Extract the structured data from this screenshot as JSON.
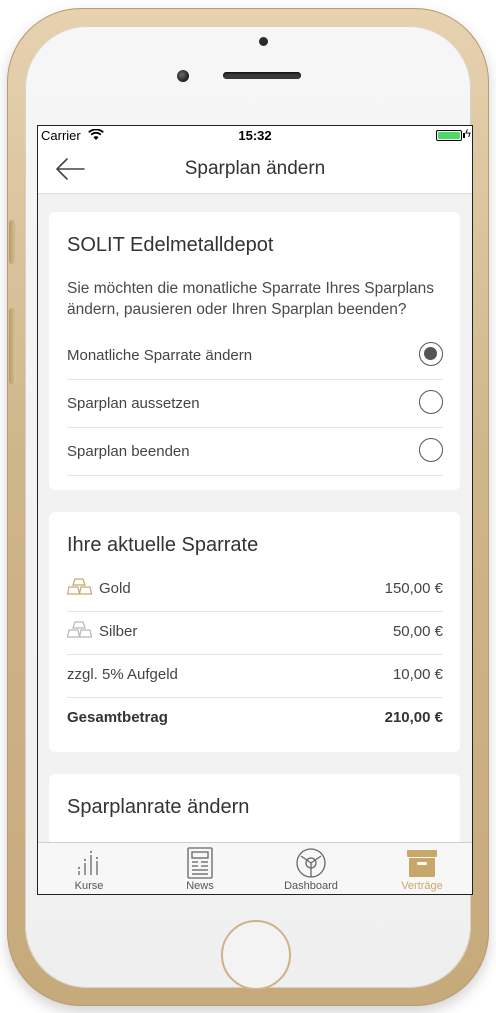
{
  "status": {
    "carrier": "Carrier",
    "time": "15:32"
  },
  "nav": {
    "title": "Sparplan ändern"
  },
  "card1": {
    "title": "SOLIT Edelmetalldepot",
    "description": "Sie möchten die monatliche Sparrate Ihres Sparplans ändern, pausieren oder Ihren Sparplan beenden?",
    "options": [
      {
        "label": "Monatliche Sparrate ändern",
        "selected": true
      },
      {
        "label": "Sparplan aussetzen",
        "selected": false
      },
      {
        "label": "Sparplan beenden",
        "selected": false
      }
    ]
  },
  "card2": {
    "title": "Ihre aktuelle Sparrate",
    "rows": [
      {
        "label": "Gold",
        "value": "150,00 €",
        "icon": "gold-bars-icon"
      },
      {
        "label": "Silber",
        "value": "50,00 €",
        "icon": "silver-bars-icon"
      },
      {
        "label": "zzgl. 5% Aufgeld",
        "value": "10,00 €"
      }
    ],
    "total": {
      "label": "Gesamtbetrag",
      "value": "210,00 €"
    }
  },
  "card3": {
    "title": "Sparplanrate ändern"
  },
  "tabs": [
    {
      "label": "Kurse",
      "icon": "chart-bars-icon"
    },
    {
      "label": "News",
      "icon": "newspaper-icon"
    },
    {
      "label": "Dashboard",
      "icon": "dashboard-icon"
    },
    {
      "label": "Verträge",
      "icon": "archive-box-icon",
      "active": true
    }
  ],
  "colors": {
    "accent": "#c8a76a",
    "gold_icon": "#c8a76a",
    "silver_icon": "#b8b8b8",
    "battery": "#4cd964"
  }
}
